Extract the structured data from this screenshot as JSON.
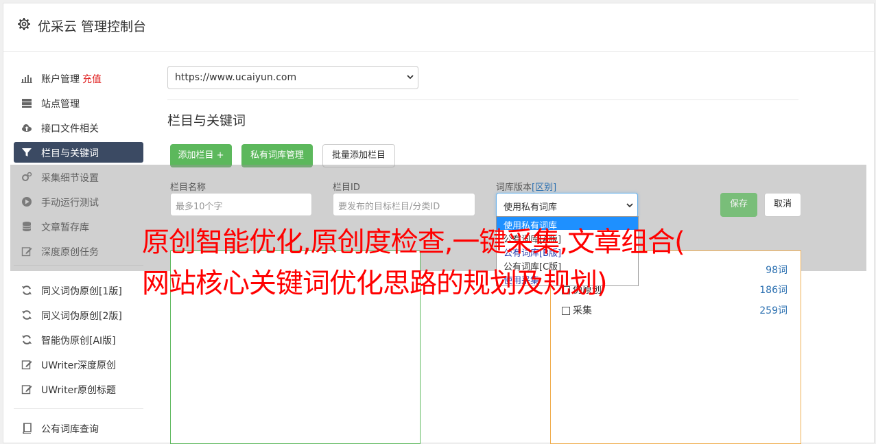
{
  "header": {
    "title": "优采云 管理控制台"
  },
  "sidebar": {
    "items": [
      {
        "label": "账户管理",
        "badge": "充值",
        "icon": "bar-chart-icon"
      },
      {
        "label": "站点管理",
        "icon": "server-icon"
      },
      {
        "label": "接口文件相关",
        "icon": "cloud-upload-icon"
      },
      {
        "label": "栏目与关键词",
        "icon": "filter-icon",
        "active": true
      },
      {
        "label": "采集细节设置",
        "icon": "gears-icon"
      },
      {
        "label": "手动运行测试",
        "icon": "play-icon"
      },
      {
        "label": "文章暂存库",
        "icon": "database-icon"
      },
      {
        "label": "深度原创任务",
        "icon": "edit-icon"
      },
      {
        "label": "同义词伪原创[1版]",
        "icon": "refresh-icon"
      },
      {
        "label": "同义词伪原创[2版]",
        "icon": "refresh-icon"
      },
      {
        "label": "智能伪原创[AI版]",
        "icon": "refresh-icon"
      },
      {
        "label": "UWriter深度原创",
        "icon": "edit-icon"
      },
      {
        "label": "UWriter原创标题",
        "icon": "edit-icon"
      },
      {
        "label": "公有词库查询",
        "icon": "book-icon"
      }
    ]
  },
  "main": {
    "site_select": {
      "value": "https://www.ucaiyun.com"
    },
    "section_title": "栏目与关键词",
    "buttons": {
      "add_column": "添加栏目 +",
      "private_lib": "私有词库管理",
      "batch_add": "批量添加栏目"
    },
    "form": {
      "col_name_label": "栏目名称",
      "col_name_placeholder": "最多10个字",
      "col_id_label": "栏目ID",
      "col_id_placeholder": "要发布的目标栏目/分类ID",
      "lib_version_label": "词库版本",
      "lib_version_link": "[区别]",
      "lib_select_value": "使用私有词库",
      "save": "保存",
      "cancel": "取消",
      "dropdown_options": [
        "使用私有词库",
        "公有词库[A版]",
        "公有词库[B版]",
        "公有词库[C版]",
        "使用采集"
      ]
    },
    "lists": {
      "rows": [
        {
          "label": "",
          "count": "98词"
        },
        {
          "label": "伪原创",
          "count": "186词"
        },
        {
          "label": "采集",
          "count": "259词"
        }
      ]
    }
  },
  "headline": {
    "line1": "原创智能优化,原创度检查,一键采集,文章组合(",
    "line2": "网站核心关键词优化思路的规划及规划)"
  },
  "colors": {
    "accent_green": "#5cb85c",
    "sidebar_active": "#3b4a63",
    "headline": "#ff0000"
  }
}
